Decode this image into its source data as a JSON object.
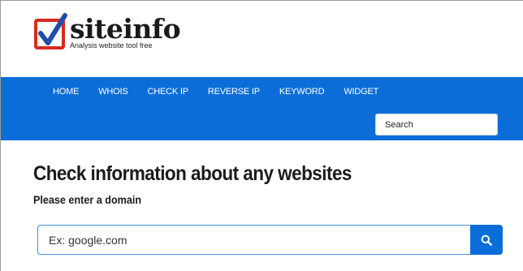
{
  "logo": {
    "name": "siteinfo",
    "tagline": "Analysis website tool free",
    "check_color": "#1f4fa6",
    "box_color": "#d42b1e"
  },
  "nav": {
    "items": [
      {
        "label": "HOME"
      },
      {
        "label": "WHOIS"
      },
      {
        "label": "CHECK IP"
      },
      {
        "label": "REVERSE IP"
      },
      {
        "label": "KEYWORD"
      },
      {
        "label": "WIDGET"
      }
    ],
    "search_placeholder": "Search"
  },
  "main": {
    "title": "Check information about any websites",
    "subtitle": "Please enter a domain",
    "input_placeholder": "Ex: google.com",
    "search_icon": "search-icon"
  },
  "colors": {
    "accent": "#0b6ed8",
    "input_border": "#4a90d9"
  }
}
